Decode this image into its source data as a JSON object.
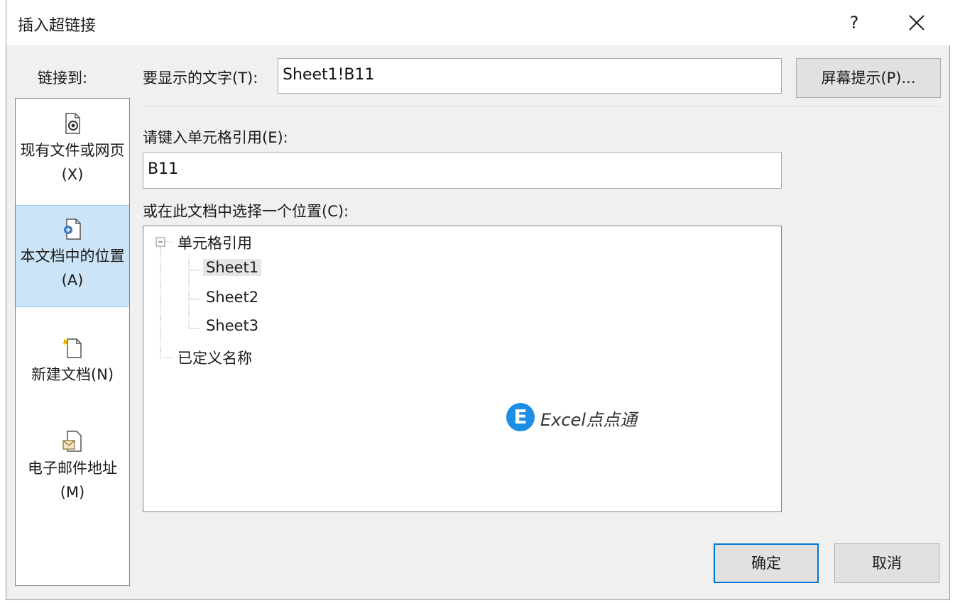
{
  "dialog": {
    "title": "插入超链接",
    "help_label": "?",
    "close_icon": "close-icon"
  },
  "sidebar": {
    "heading": "链接到:",
    "items": [
      {
        "label": "现有文件或网页(X)",
        "icon": "existing-file-icon",
        "selected": false
      },
      {
        "label": "本文档中的位置(A)",
        "icon": "place-in-document-icon",
        "selected": true
      },
      {
        "label": "新建文档(N)",
        "icon": "new-document-icon",
        "selected": false
      },
      {
        "label": "电子邮件地址(M)",
        "icon": "email-address-icon",
        "selected": false
      }
    ]
  },
  "form": {
    "display_text_label": "要显示的文字(T):",
    "display_text_value": "Sheet1!B11",
    "screentip_button": "屏幕提示(P)...",
    "cell_ref_label": "请键入单元格引用(E):",
    "cell_ref_value": "B11",
    "place_label": "或在此文档中选择一个位置(C):"
  },
  "tree": {
    "root": "单元格引用",
    "sheets": [
      "Sheet1",
      "Sheet2",
      "Sheet3"
    ],
    "selected_sheet": "Sheet1",
    "defined_names": "已定义名称"
  },
  "watermark": {
    "logo_letter": "E",
    "text": "Excel点点通"
  },
  "buttons": {
    "ok": "确定",
    "cancel": "取消"
  },
  "colors": {
    "selected_bg": "#cce4f7",
    "accent": "#0078d7",
    "logo": "#1a8fe3"
  }
}
